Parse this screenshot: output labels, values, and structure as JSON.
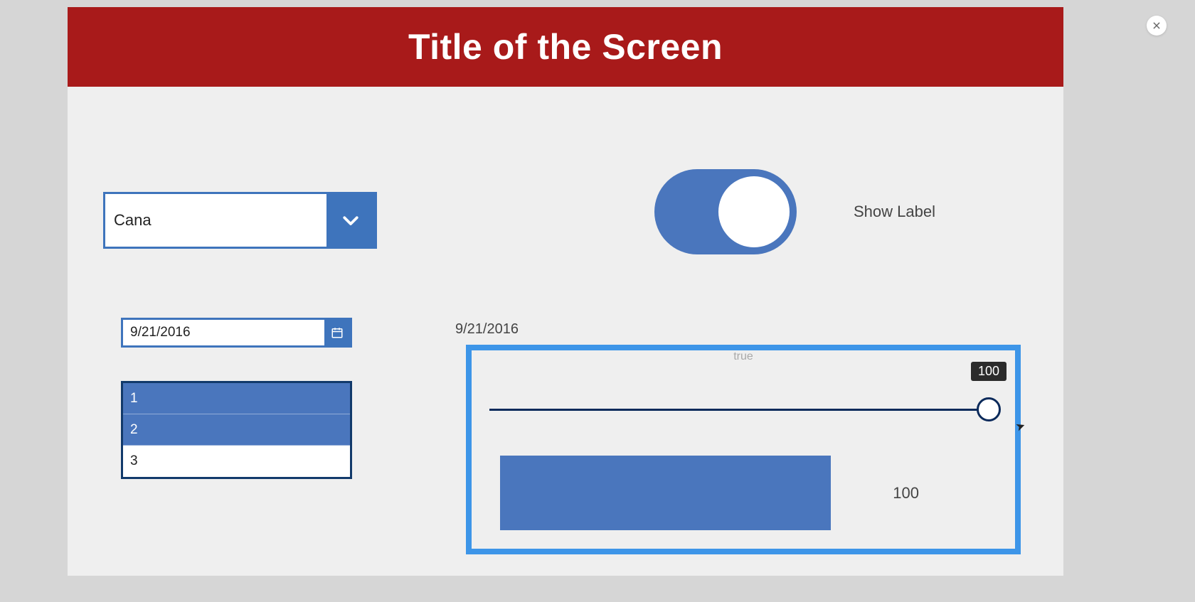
{
  "header": {
    "title": "Title of the Screen"
  },
  "dropdown": {
    "value": "Cana"
  },
  "toggle": {
    "on": true,
    "label": "Show Label"
  },
  "date": {
    "value": "9/21/2016",
    "echo": "9/21/2016"
  },
  "list": {
    "items": [
      "1",
      "2",
      "3"
    ],
    "selected": [
      0,
      1
    ]
  },
  "panel": {
    "ghost_text": "true",
    "slider_tooltip": "100",
    "gauge_value": "100"
  }
}
